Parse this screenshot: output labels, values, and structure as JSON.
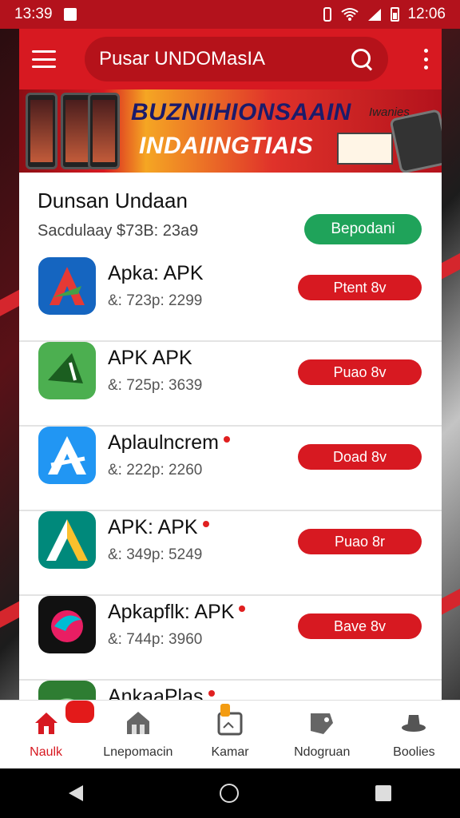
{
  "status_bar": {
    "time_left": "13:39",
    "time_right": "12:06"
  },
  "header": {
    "title": "Pusar UNDOMasIA"
  },
  "banner": {
    "headline": "BUZNIIHIONSAAIN",
    "subline": "INDAIINGTIAIS",
    "tag": "Iwanies"
  },
  "section": {
    "title": "Dunsan Undaan",
    "subtitle": "Sacdulaay $73B: 23a9",
    "action_label": "Bepodani"
  },
  "apps": [
    {
      "name": "Apka: APK",
      "meta": "&: 723p: 2299",
      "button": "Ptent 8v",
      "icon": "a-logo-blue-icon",
      "colors": [
        "#1565c0",
        "#e53935",
        "#43a047"
      ],
      "dot": false
    },
    {
      "name": "APK APK",
      "meta": "&: 725p: 3639",
      "button": "Puao 8v",
      "icon": "a-logo-green-icon",
      "colors": [
        "#4caf50",
        "#1b5e20",
        "#ffffff"
      ],
      "dot": false
    },
    {
      "name": "Aplaulncrem",
      "meta": "&: 222p: 2260",
      "button": "Doad 8v",
      "icon": "a-logo-lightblue-icon",
      "colors": [
        "#2196f3",
        "#ffffff",
        "#1976d2"
      ],
      "dot": true
    },
    {
      "name": "APK: APK",
      "meta": "&: 349p: 5249",
      "button": "Puao 8r",
      "icon": "a-logo-teal-icon",
      "colors": [
        "#00897b",
        "#fbc02d",
        "#ffffff"
      ],
      "dot": true
    },
    {
      "name": "Apkapflk: APK",
      "meta": "&: 744p: 3960",
      "button": "Bave 8v",
      "icon": "swirl-logo-icon",
      "colors": [
        "#111111",
        "#e91e63",
        "#00bcd4"
      ],
      "dot": true
    },
    {
      "name": "AnkaaPlas",
      "meta": "",
      "button": "",
      "icon": "leaf-logo-icon",
      "colors": [
        "#2e7d32",
        "#66bb6a",
        "#a5d6a7"
      ],
      "dot": true
    }
  ],
  "bottom_nav": [
    {
      "label": "Naulk",
      "icon": "home-icon",
      "active": true
    },
    {
      "label": "Lnepomacin",
      "icon": "store-icon",
      "active": false
    },
    {
      "label": "Kamar",
      "icon": "inbox-icon",
      "active": false
    },
    {
      "label": "Ndogruan",
      "icon": "tag-icon",
      "active": false
    },
    {
      "label": "Boolies",
      "icon": "hat-icon",
      "active": false
    }
  ],
  "accent_color": "#d71921",
  "success_color": "#1fa35a"
}
